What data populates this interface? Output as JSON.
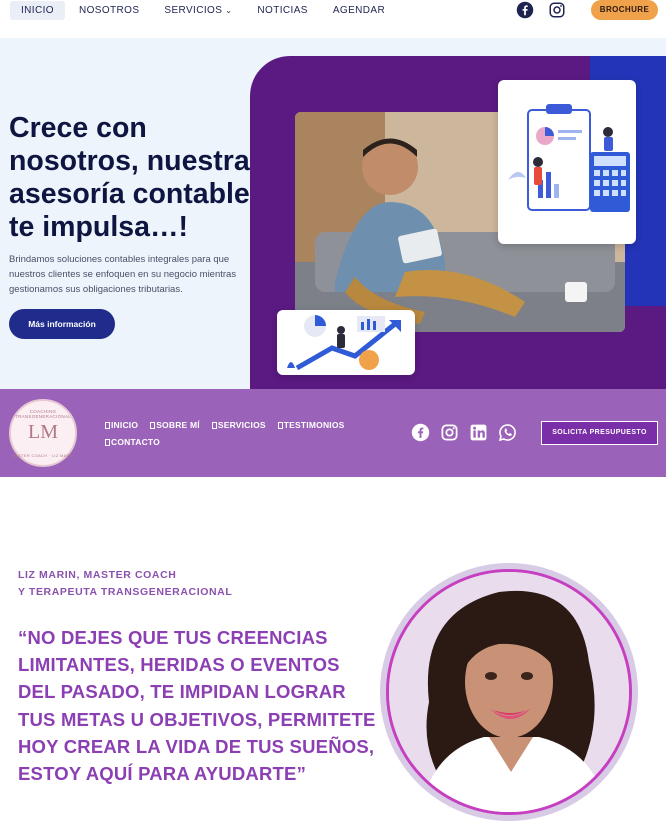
{
  "topnav": {
    "items": [
      "INICIO",
      "NOSOTROS",
      "SERVICIOS",
      "NOTICIAS",
      "AGENDAR"
    ],
    "services_chevron": "⌄",
    "brochure_label": "BROCHURE",
    "social_icons": [
      "facebook-icon",
      "instagram-icon"
    ]
  },
  "hero": {
    "title": "Crece con nosotros, nuestra asesoría contable te impulsa…!",
    "text": "Brindamos soluciones contables integrales para que nuestros clientes se enfoquen en su negocio mientras gestionamos sus obligaciones tributarias.",
    "cta_label": "Más información"
  },
  "band": {
    "menu": [
      "INICIO",
      "SOBRE MÍ",
      "SERVICIOS",
      "TESTIMONIOS",
      "CONTACTO"
    ],
    "quote_button": "SOLICITA PRESUPUESTO",
    "social_icons": [
      "facebook-icon",
      "instagram-icon",
      "linkedin-icon",
      "whatsapp-icon"
    ],
    "logo_initials": "LM",
    "logo_ring_top": "COACHING TRANSGENERACIONAL",
    "logo_ring_bottom": "MASTER COACH · LIZ MARIN"
  },
  "coach": {
    "eyebrow_line1": "LIZ MARIN, MASTER COACH",
    "eyebrow_line2": "Y TERAPEUTA TRANSGENERACIONAL",
    "quote": "“NO DEJES QUE TUS CREENCIAS LIMITANTES, HERIDAS O EVENTOS DEL PASADO, TE IMPIDAN LOGRAR TUS METAS U OBJETIVOS, PERMITETE HOY CREAR LA VIDA DE TUS SUEÑOS, ESTOY AQUÍ PARA AYUDARTE”"
  },
  "colors": {
    "accent_orange": "#f0a24a",
    "navy": "#1f2c8c",
    "band_purple": "#9a62b8",
    "quote_purple": "#8b3fb3"
  }
}
